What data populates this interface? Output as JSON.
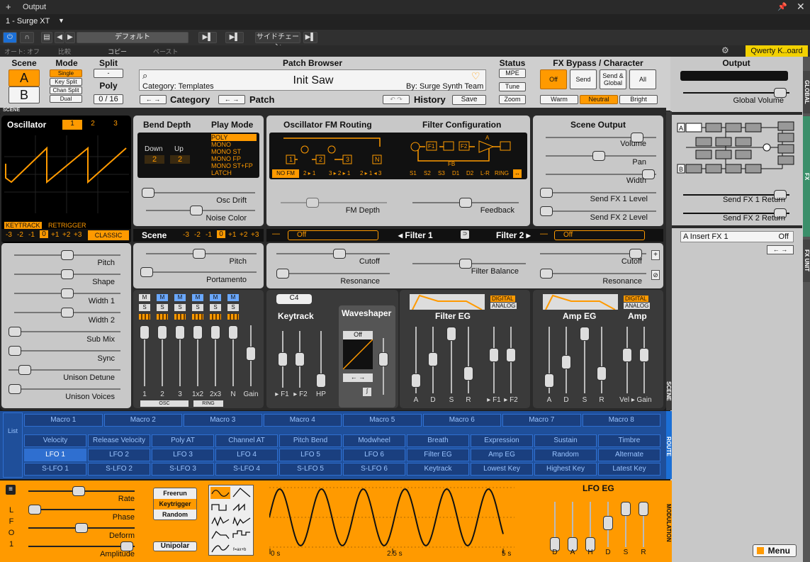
{
  "host": {
    "window_title": "Output",
    "track": "1 - Surge XT",
    "preset": "デフォルト",
    "sidechain": "サイドチェーン",
    "auto": "オート: オフ",
    "compare": "比較",
    "copy": "コピー",
    "paste": "ペースト",
    "keyboard": "Qwerty K..oard",
    "plus": "+",
    "dropdown_arrow": "▼"
  },
  "header": {
    "scene_label": "Scene",
    "scene_a": "A",
    "scene_b": "B",
    "mode_label": "Mode",
    "modes": [
      "Single",
      "Key Split",
      "Chan Split",
      "Dual"
    ],
    "split_label": "Split",
    "split_value": "-",
    "poly_label": "Poly",
    "poly_value": "0 / 16",
    "patch_browser_label": "Patch Browser",
    "category": "Category: Templates",
    "patch_name": "Init Saw",
    "author": "By: Surge Synth Team",
    "category_nav": "Category",
    "patch_nav": "Patch",
    "history_nav": "History",
    "save": "Save",
    "status_label": "Status",
    "mpe": "MPE",
    "tune": "Tune",
    "zoom": "Zoom",
    "fx_label": "FX Bypass / Character",
    "fx_buttons": [
      "Off",
      "Send",
      "Send & Global",
      "All"
    ],
    "character": [
      "Warm",
      "Neutral",
      "Bright"
    ],
    "output_label": "Output",
    "global_volume": "Global Volume"
  },
  "section_label": "SCENE",
  "osc": {
    "title": "Oscillator",
    "nums": [
      "1",
      "2",
      "3"
    ],
    "keytrack": "KEYTRACK",
    "retrigger": "RETRIGGER",
    "octaves": [
      "-3",
      "-2",
      "-1",
      "0",
      "+1",
      "+2",
      "+3"
    ],
    "type": "CLASSIC",
    "params": [
      "Pitch",
      "Shape",
      "Width 1",
      "Width 2",
      "Sub Mix",
      "Sync",
      "Unison Detune",
      "Unison Voices"
    ]
  },
  "bend": {
    "title": "Bend Depth",
    "down": "Down",
    "up": "Up",
    "down_v": "2",
    "up_v": "2"
  },
  "playmode": {
    "title": "Play Mode",
    "options": [
      "POLY",
      "MONO",
      "MONO ST",
      "MONO FP",
      "MONO ST+FP",
      "LATCH"
    ]
  },
  "osc_drift": "Osc Drift",
  "noise_color": "Noise Color",
  "fm": {
    "title": "Oscillator FM Routing",
    "modes": [
      "NO FM",
      "2 ▸ 1",
      "3 ▸ 2 ▸ 1",
      "2 ▸ 1 ◂ 3"
    ],
    "depth": "FM Depth",
    "boxes": [
      "1",
      "2",
      "3",
      "N"
    ]
  },
  "filtercfg": {
    "title": "Filter Configuration",
    "opts": [
      "S1",
      "S2",
      "S3",
      "D1",
      "D2",
      "L-R",
      "RING"
    ],
    "feedback": "Feedback",
    "fb": "FB",
    "f1": "F1",
    "f2": "F2",
    "a": "A"
  },
  "sceneout": {
    "title": "Scene Output",
    "params": [
      "Volume",
      "Pan",
      "Width",
      "Send FX 1 Level",
      "Send FX 2 Level"
    ]
  },
  "scene": {
    "title": "Scene",
    "octaves": [
      "-3",
      "-2",
      "-1",
      "0",
      "+1",
      "+2",
      "+3"
    ],
    "pitch": "Pitch",
    "portamento": "Portamento"
  },
  "filters": {
    "f1_type": "Off",
    "f1": "◂ Filter 1",
    "f2": "Filter 2 ▸",
    "f2_type": "Off",
    "cutoff": "Cutoff",
    "resonance": "Resonance",
    "balance": "Filter Balance"
  },
  "mixer": {
    "m": "M",
    "s": "S",
    "labels": [
      "1",
      "2",
      "3",
      "1x2",
      "2x3",
      "N",
      "Gain"
    ],
    "osc": "OSC",
    "ring": "RING"
  },
  "keytrack": {
    "note": "C4",
    "title": "Keytrack",
    "labels": [
      "▸ F1",
      "▸ F2"
    ],
    "hp": "HP",
    "ws_title": "Waveshaper",
    "ws_type": "Off"
  },
  "filtereg": {
    "title": "Filter EG",
    "digital": "DIGITAL",
    "analog": "ANALOG",
    "labels": [
      "A",
      "D",
      "S",
      "R",
      "▸ F1",
      "▸ F2"
    ]
  },
  "ampeg": {
    "title": "Amp EG",
    "amp": "Amp",
    "digital": "DIGITAL",
    "analog": "ANALOG",
    "labels": [
      "A",
      "D",
      "S",
      "R",
      "Vel ▸",
      "Gain"
    ]
  },
  "macros": [
    "Macro 1",
    "Macro 2",
    "Macro 3",
    "Macro 4",
    "Macro 5",
    "Macro 6",
    "Macro 7",
    "Macro 8"
  ],
  "sources_row1": [
    "Velocity",
    "Release Velocity",
    "Poly AT",
    "Channel AT",
    "Pitch Bend",
    "Modwheel",
    "Breath",
    "Expression",
    "Sustain",
    "Timbre"
  ],
  "sources_row2": [
    "LFO 1",
    "LFO 2",
    "LFO 3",
    "LFO 4",
    "LFO 5",
    "LFO 6",
    "Filter EG",
    "Amp EG",
    "Random",
    "Alternate"
  ],
  "sources_row3": [
    "S-LFO 1",
    "S-LFO 2",
    "S-LFO 3",
    "S-LFO 4",
    "S-LFO 5",
    "S-LFO 6",
    "Keytrack",
    "Lowest Key",
    "Highest Key",
    "Latest Key"
  ],
  "list_label": "List",
  "lfo": {
    "name": "LFO 1",
    "params": [
      "Rate",
      "Phase",
      "Deform",
      "Amplitude"
    ],
    "trig": [
      "Freerun",
      "Keytrigger",
      "Random"
    ],
    "unipolar": "Unipolar",
    "t0": "0 s",
    "t1": "2.5 s",
    "t2": "5 s",
    "eg": "LFO EG",
    "eg_labels": [
      "D",
      "A",
      "H",
      "D",
      "S",
      "R"
    ]
  },
  "right": {
    "send1": "Send FX 1 Return",
    "send2": "Send FX 2 Return",
    "insert": "A Insert FX 1",
    "insert_val": "Off",
    "menu": "Menu",
    "a": "A",
    "b": "B"
  },
  "tabs": [
    "GLOBAL",
    "FX",
    "FX UNIT",
    "SCENE",
    "ROUTE",
    "MODULATION"
  ],
  "colors": {
    "accent": "#ff9a00",
    "mod": "#1f4f9a"
  }
}
